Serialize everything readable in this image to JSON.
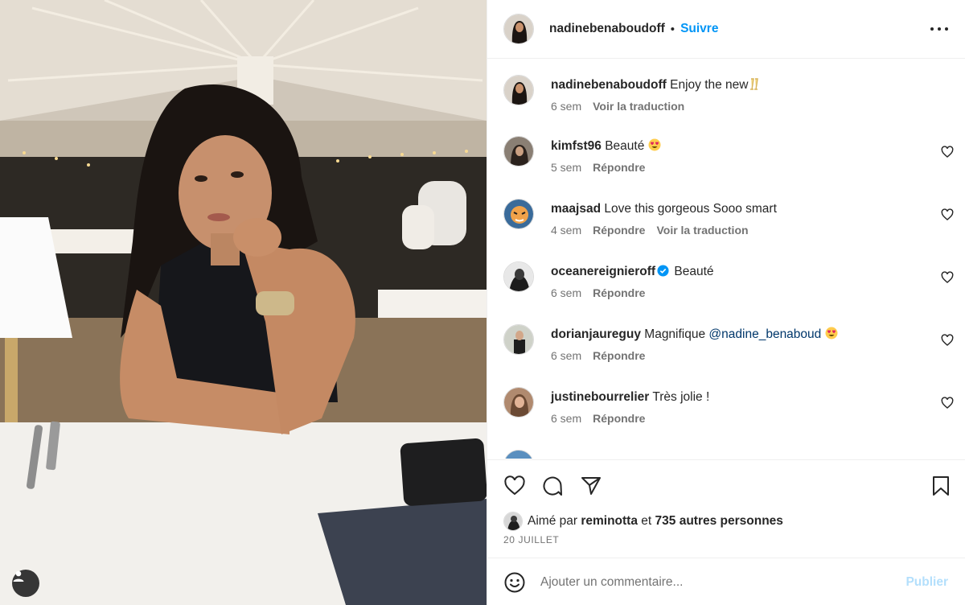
{
  "post": {
    "author": "nadinebenaboudoff",
    "follow_label": "Suivre",
    "separator": "•"
  },
  "caption": {
    "author": "nadinebenaboudoff",
    "text": "Enjoy the new",
    "emoji": "champagne-toast-icon",
    "time": "6 sem",
    "translate_label": "Voir la traduction"
  },
  "comments": [
    {
      "user": "kimfst96",
      "text": "Beauté",
      "emoji": "heart-eyes-icon",
      "time": "5 sem",
      "reply_label": "Répondre"
    },
    {
      "user": "maajsad",
      "text": "Love this gorgeous Sooo smart",
      "time": "4 sem",
      "reply_label": "Répondre",
      "translate_label": "Voir la traduction"
    },
    {
      "user": "oceanereignieroff",
      "verified": true,
      "text": "Beauté",
      "time": "6 sem",
      "reply_label": "Répondre"
    },
    {
      "user": "dorianjaureguy",
      "text": "Magnifique",
      "mention": "@nadine_benaboud",
      "emoji": "heart-eyes-icon",
      "time": "6 sem",
      "reply_label": "Répondre"
    },
    {
      "user": "justinebourrelier",
      "text": "Très jolie !",
      "time": "6 sem",
      "reply_label": "Répondre"
    }
  ],
  "likes": {
    "prefix": "Aimé par",
    "user": "reminotta",
    "conjunction": "et",
    "others": "735 autres personnes"
  },
  "date": "20 JUILLET",
  "composer": {
    "placeholder": "Ajouter un commentaire...",
    "publish_label": "Publier"
  },
  "icons": {
    "like": "heart-icon",
    "comment": "comment-icon",
    "share": "paper-plane-icon",
    "save": "bookmark-icon",
    "more": "more-options-icon",
    "emoji": "smiley-icon",
    "tag": "user-tag-icon"
  },
  "colors": {
    "accent": "#0095f6",
    "publish_disabled": "#b3dffc",
    "mention": "#00376b",
    "verified": "#0095f6"
  }
}
